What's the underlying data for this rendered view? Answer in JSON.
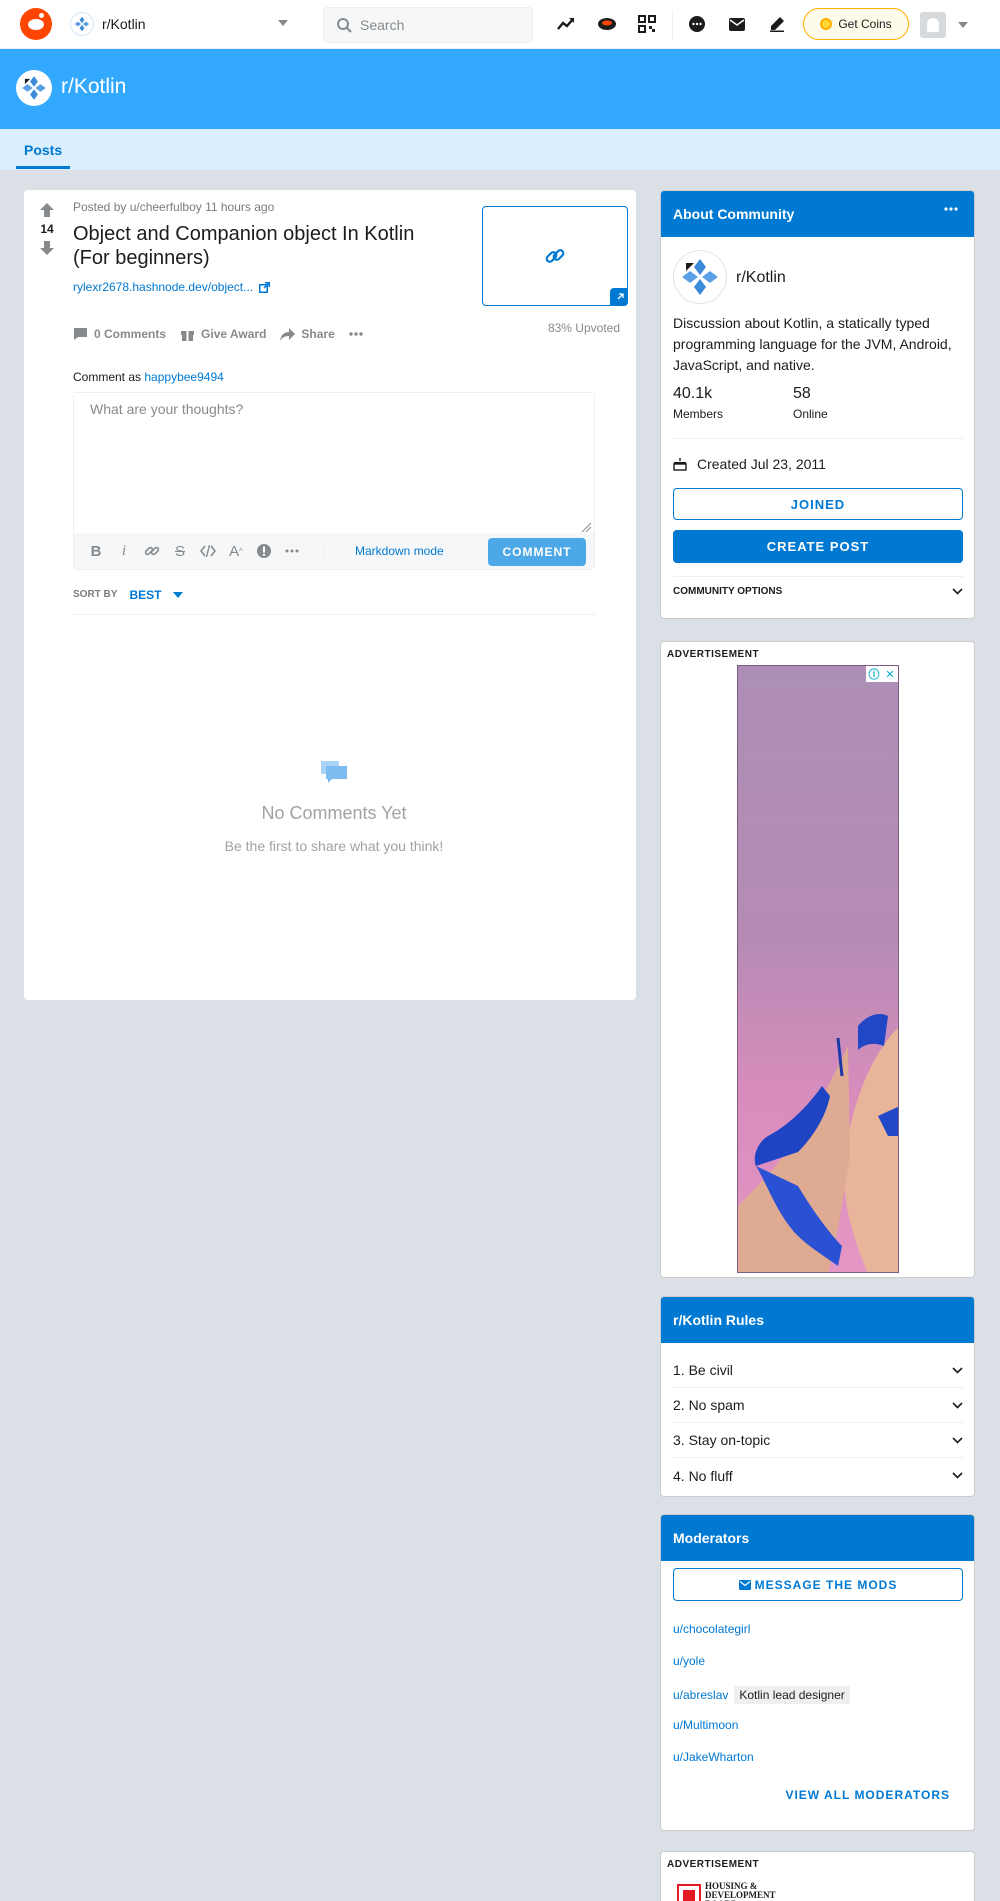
{
  "header": {
    "community": "r/Kotlin",
    "search_placeholder": "Search",
    "get_coins": "Get Coins"
  },
  "banner": {
    "title": "r/Kotlin"
  },
  "tabs": {
    "posts": "Posts"
  },
  "post": {
    "votes": "14",
    "meta": "Posted by u/cheerfulboy 11 hours ago",
    "title": "Object and Companion object In Kotlin (For beginners)",
    "link": "rylexr2678.hashnode.dev/object...",
    "comments": "0 Comments",
    "give_award": "Give Award",
    "share": "Share",
    "upvoted": "83% Upvoted"
  },
  "comment_box": {
    "label": "Comment as",
    "username": "happybee9494",
    "placeholder": "What are your thoughts?",
    "markdown_mode": "Markdown mode",
    "submit": "COMMENT"
  },
  "sort": {
    "label": "SORT BY",
    "value": "BEST"
  },
  "empty": {
    "title": "No Comments Yet",
    "subtitle": "Be the first to share what you think!"
  },
  "about": {
    "header": "About Community",
    "name": "r/Kotlin",
    "description": "Discussion about Kotlin, a statically typed programming language for the JVM, Android, JavaScript, and native.",
    "members_count": "40.1k",
    "members_label": "Members",
    "online_count": "58",
    "online_label": "Online",
    "created": "Created Jul 23, 2011",
    "joined": "JOINED",
    "create_post": "CREATE POST",
    "community_options": "COMMUNITY OPTIONS"
  },
  "ad": {
    "label": "ADVERTISEMENT",
    "advertiser": "HOUSING & DEVELOPMENT BOARD"
  },
  "rules": {
    "header": "r/Kotlin Rules",
    "items": [
      "1. Be civil",
      "2. No spam",
      "3. Stay on-topic",
      "4. No fluff"
    ]
  },
  "moderators": {
    "header": "Moderators",
    "message": "MESSAGE THE MODS",
    "list": [
      "u/chocolategirl",
      "u/yole",
      "u/abreslav",
      "u/Multimoon",
      "u/JakeWharton"
    ],
    "flair": "Kotlin lead designer",
    "view_all": "VIEW ALL MODERATORS"
  },
  "colors": {
    "accent": "#0079d3",
    "banner": "#33a8ff",
    "brand": "#ff4500"
  }
}
